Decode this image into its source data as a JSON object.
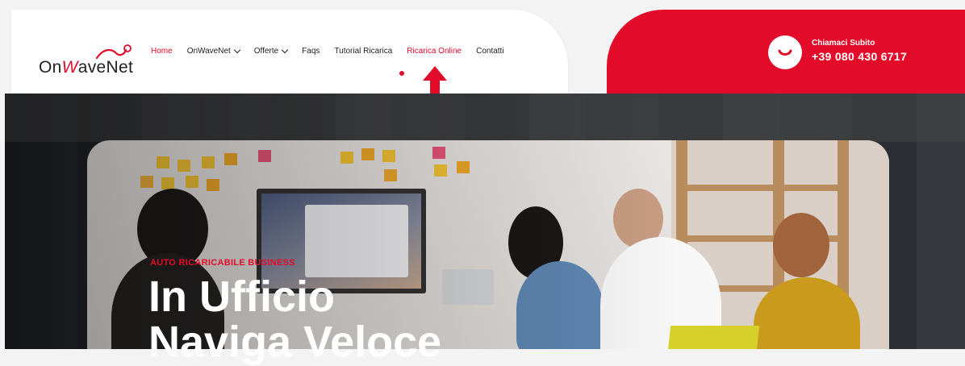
{
  "brand": {
    "logo_text_before": "On",
    "logo_text_w": "W",
    "logo_text_after": "aveNet"
  },
  "nav": {
    "items": [
      {
        "label": "Home",
        "active": true
      },
      {
        "label": "OnWaveNet",
        "dropdown": true
      },
      {
        "label": "Offerte",
        "dropdown": true
      },
      {
        "label": "Faqs"
      },
      {
        "label": "Tutorial Ricarica"
      },
      {
        "label": "Ricarica Online",
        "highlighted": true
      },
      {
        "label": "Contatti"
      }
    ]
  },
  "call": {
    "label": "Chiamaci Subito",
    "phone": "+39 080 430 6717"
  },
  "hero": {
    "tagline": "AUTO RICARICABILE BUSINESS",
    "title_line1": "In Ufficio",
    "title_line2": "Naviga Veloce"
  },
  "colors": {
    "accent": "#e30b2a",
    "white": "#ffffff"
  },
  "icons": {
    "arrow": "arrow-up-icon",
    "phone": "phone-icon",
    "chevron": "chevron-down-icon"
  }
}
